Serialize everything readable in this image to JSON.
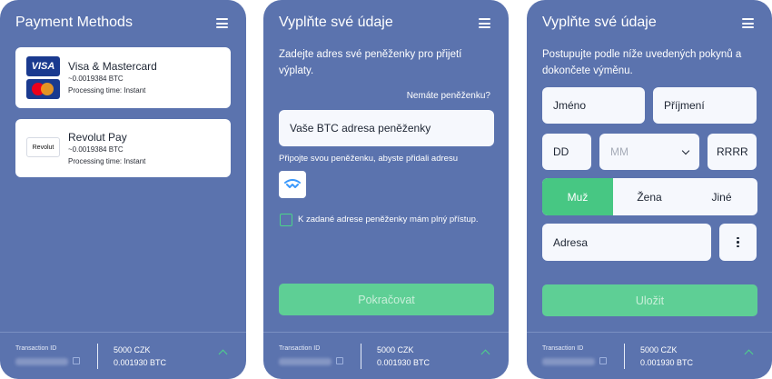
{
  "colors": {
    "panel": "#5b73ae",
    "accent": "#47c783",
    "button": "#5ecf95",
    "input": "#f6f8fd"
  },
  "panel1": {
    "title": "Payment Methods",
    "methods": [
      {
        "name": "Visa & Mastercard",
        "amount": "~0.0019384 BTC",
        "time": "Processing time: Instant",
        "logo1": "VISA",
        "icons": [
          "visa-logo",
          "mastercard-logo"
        ]
      },
      {
        "name": "Revolut Pay",
        "amount": "~0.0019384 BTC",
        "time": "Processing time: Instant",
        "logo1": "Revolut",
        "icons": [
          "revolut-logo"
        ]
      }
    ]
  },
  "panel2": {
    "title": "Vyplňte své údaje",
    "intro": "Zadejte adres své peněženky pro přijetí výplaty.",
    "no_wallet_link": "Nemáte peněženku?",
    "wallet_input_placeholder": "Vaše BTC adresa peněženky",
    "connect_text": "Připojte svou peněženku, abyste přidali adresu",
    "checkbox_label": "K zadané adrese peněženky mám plný přístup.",
    "continue_button": "Pokračovat"
  },
  "panel3": {
    "title": "Vyplňte své údaje",
    "intro": "Postupujte podle níže uvedených pokynů a dokončete výměnu.",
    "first_name_placeholder": "Jméno",
    "last_name_placeholder": "Příjmení",
    "day_placeholder": "DD",
    "month_placeholder": "MM",
    "year_placeholder": "RRRR",
    "gender_options": [
      "Muž",
      "Žena",
      "Jiné"
    ],
    "gender_selected": "Muž",
    "address_placeholder": "Adresa",
    "save_button": "Uložit"
  },
  "footer": {
    "tx_label": "Transaction ID",
    "amount_czk": "5000 CZK",
    "amount_btc": "0.001930 BTC"
  }
}
